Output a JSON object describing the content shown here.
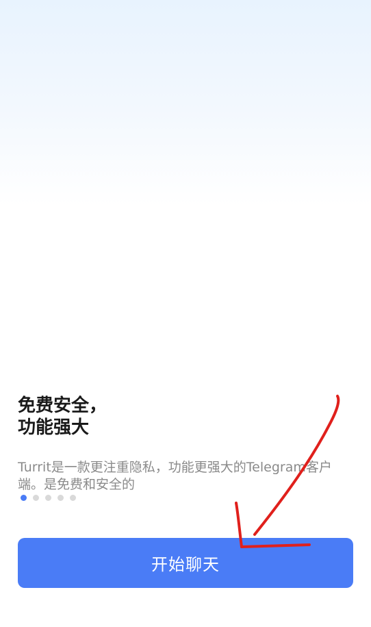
{
  "onboarding": {
    "title_line1": "免费安全，",
    "title_line2": "功能强大",
    "description": "Turrit是一款更注重隐私，功能更强大的Telegram客户端。是免费和安全的",
    "pagination": {
      "total": 5,
      "current": 1
    },
    "start_button_label": "开始聊天"
  },
  "colors": {
    "accent": "#4a7cf6",
    "annotation": "#e0201c",
    "background_top": "#e8f3fe"
  }
}
